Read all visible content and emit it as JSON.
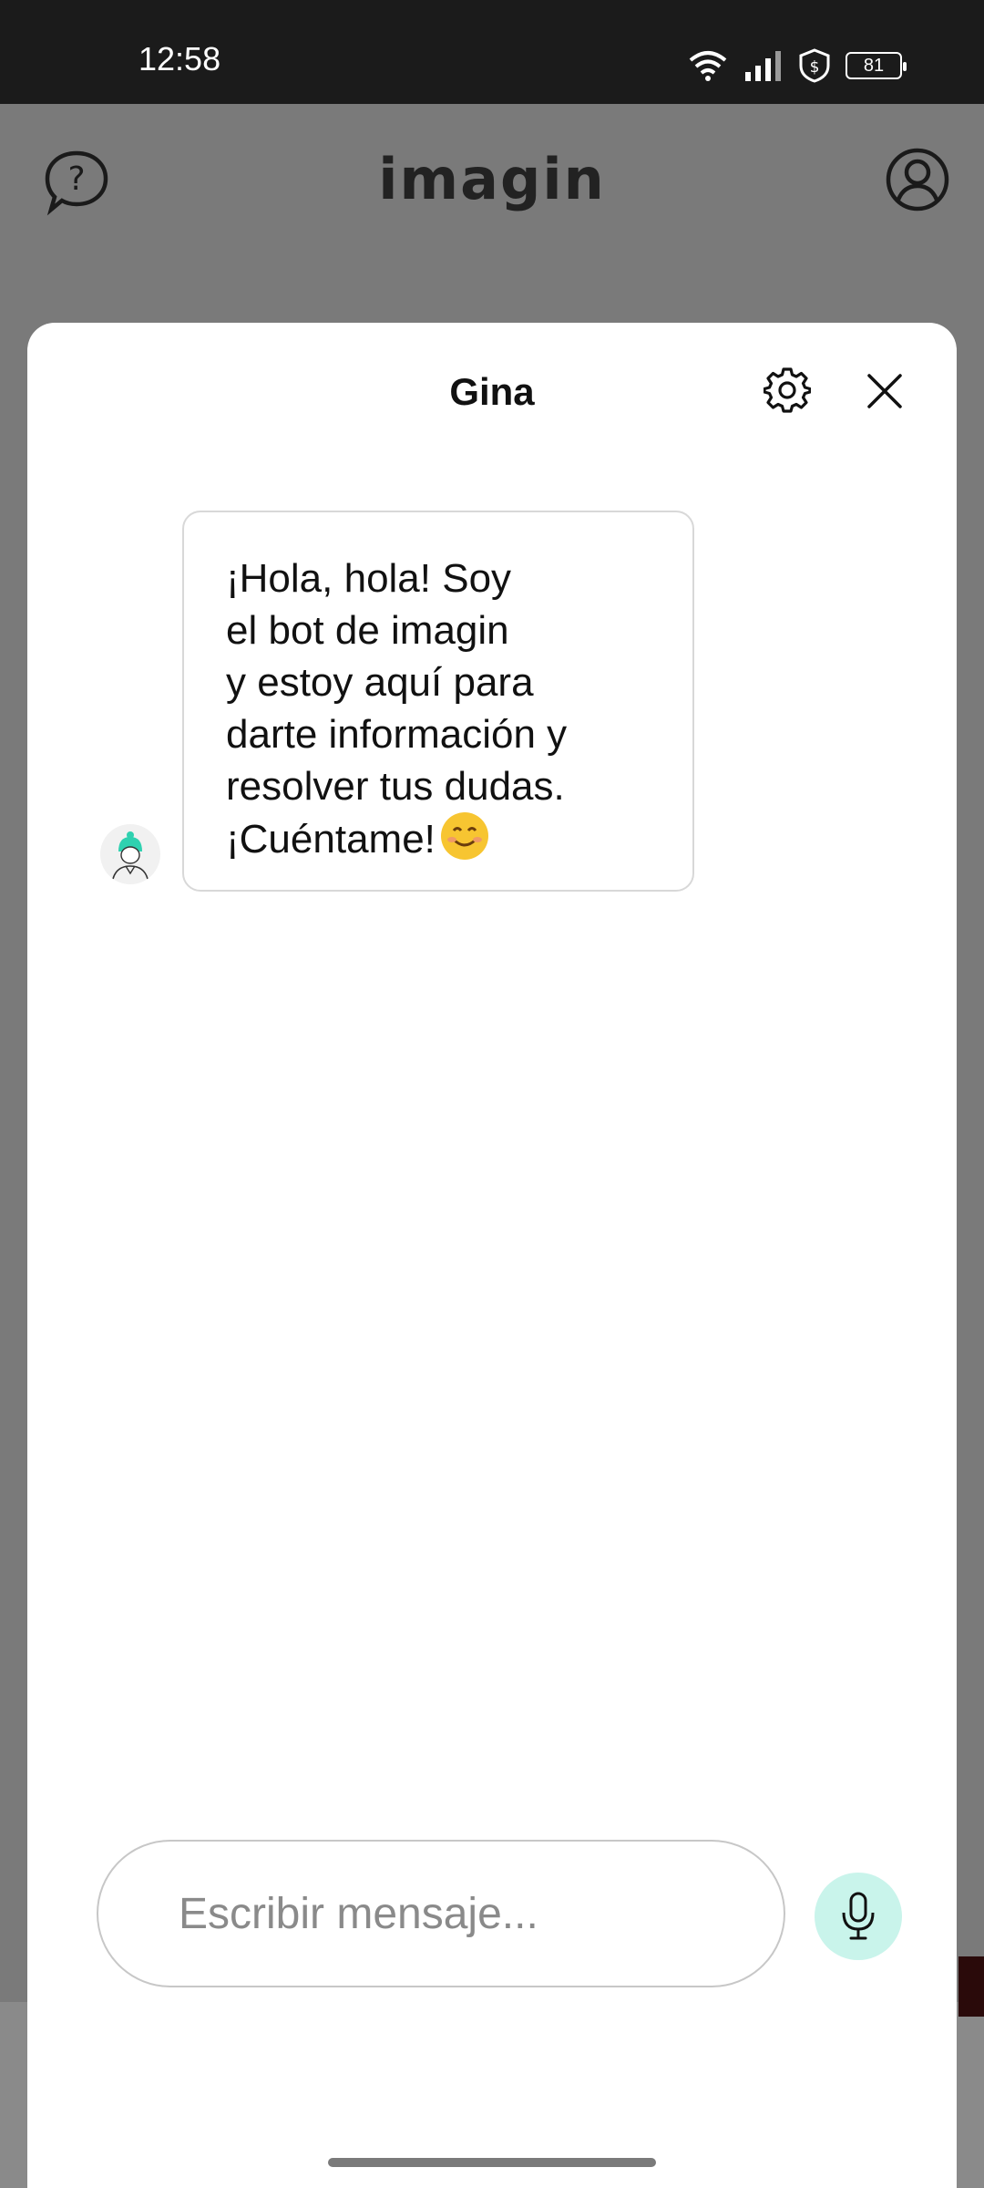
{
  "status_bar": {
    "time": "12:58",
    "battery": "81"
  },
  "app_header": {
    "brand": "imagin",
    "help_icon": "help-chat-icon",
    "profile_icon": "user-profile-icon"
  },
  "chat": {
    "title": "Gina",
    "settings_icon": "gear-icon",
    "close_icon": "close-icon",
    "message": {
      "lines": [
        "¡Hola, hola! Soy",
        "el bot de imagin",
        "y estoy aquí para",
        "darte información y",
        "resolver tus dudas.",
        "¡Cuéntame!"
      ],
      "emoji": "smiling-face-emoji"
    },
    "input_placeholder": "Escribir mensaje...",
    "mic_icon": "microphone-icon"
  },
  "colors": {
    "accent_mint": "#c9f4eb",
    "avatar_teal": "#2fd1b0",
    "overlay_gray": "#7a7a7a"
  }
}
